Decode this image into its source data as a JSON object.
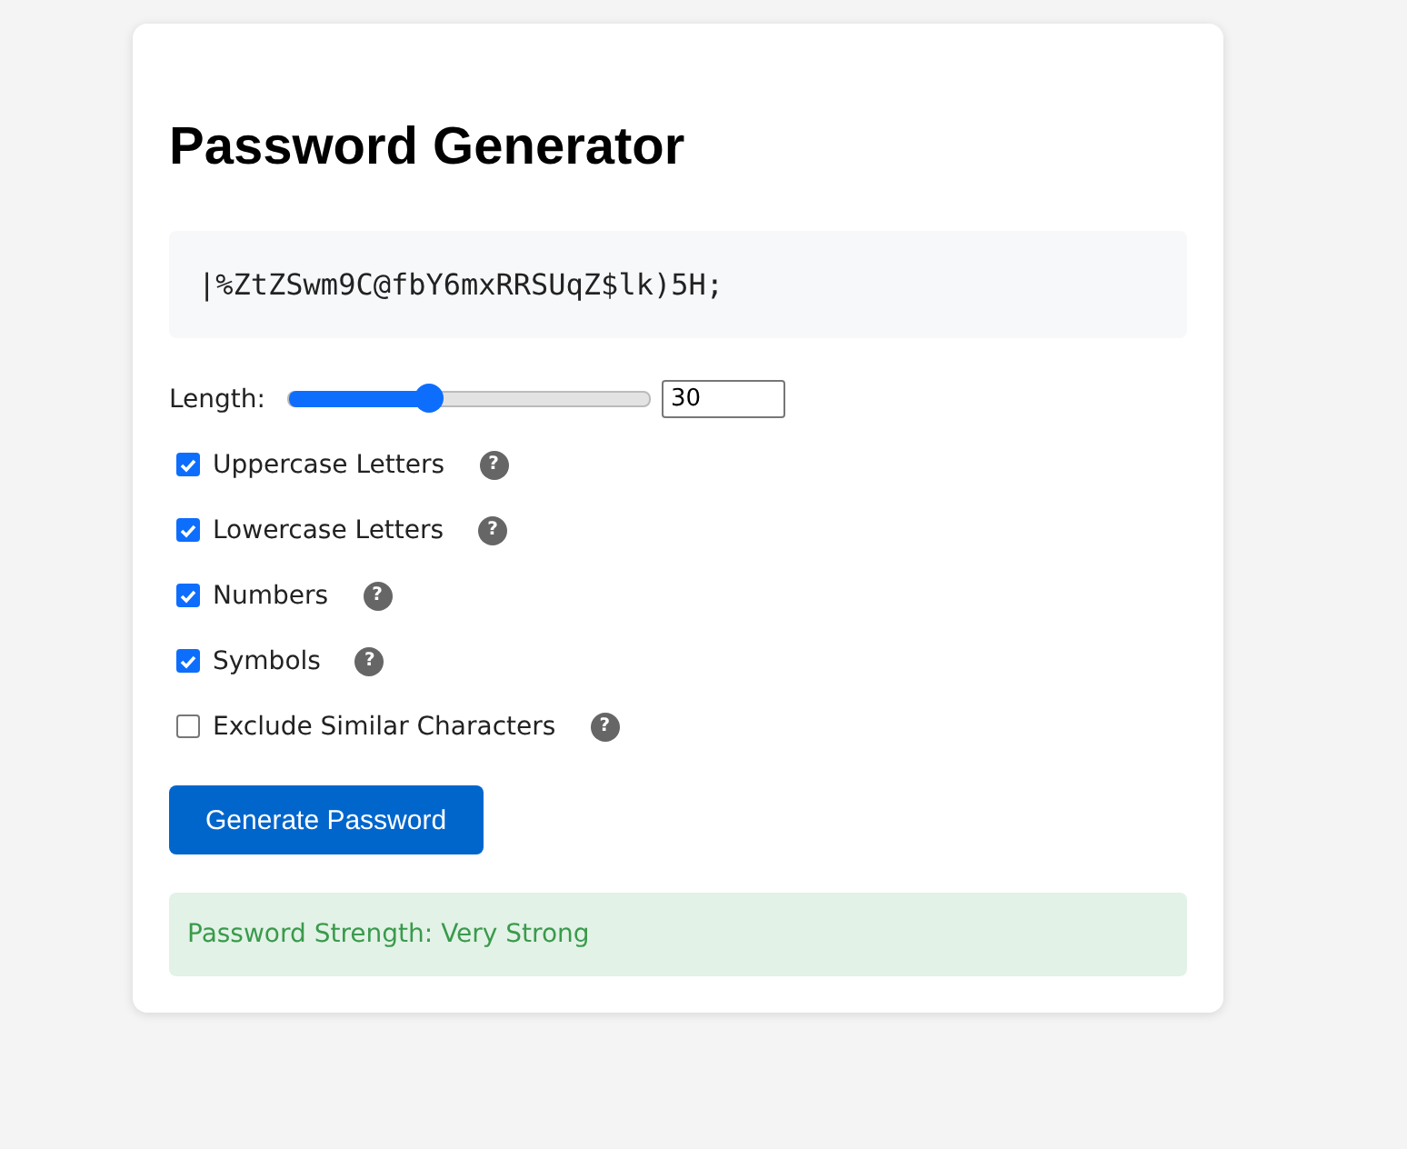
{
  "title": "Password Generator",
  "password": "|%ZtZSwm9C@fbY6mxRRSUqZ$lk)5H;",
  "length": {
    "label": "Length:",
    "level": 0.39,
    "value": "30"
  },
  "options": [
    {
      "label": "Uppercase Letters",
      "checked": true,
      "help": "?"
    },
    {
      "label": "Lowercase Letters",
      "checked": true,
      "help": "?"
    },
    {
      "label": "Numbers",
      "checked": true,
      "help": "?"
    },
    {
      "label": "Symbols",
      "checked": true,
      "help": "?"
    },
    {
      "label": "Exclude Similar Characters",
      "checked": false,
      "help": "?"
    }
  ],
  "button": "Generate Password",
  "strength": "Password Strength: Very Strong"
}
